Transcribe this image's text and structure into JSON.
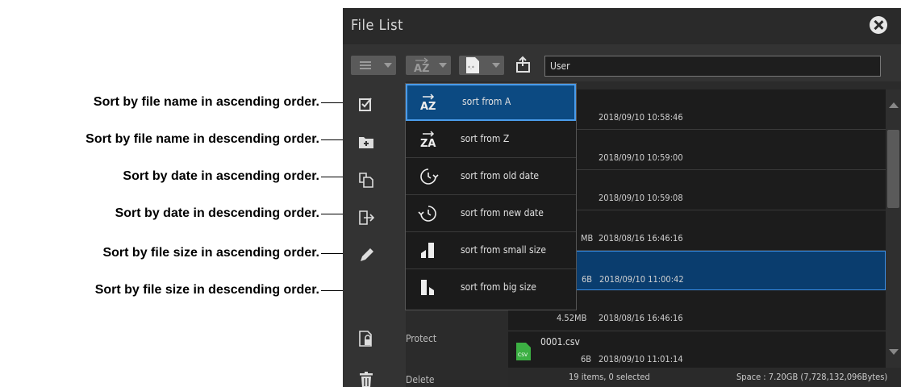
{
  "annotations": [
    "Sort by file name in ascending order.",
    "Sort by file name in descending order.",
    "Sort by date in ascending order.",
    "Sort by date in descending order.",
    "Sort by file size in ascending order.",
    "Sort by file size in descending order."
  ],
  "window": {
    "title": "File List",
    "close_icon": "close-circle-icon"
  },
  "toolbar": {
    "path_value": "User"
  },
  "sidebar": {
    "items": [
      {
        "icon": "select-check-icon",
        "label": ""
      },
      {
        "icon": "new-folder-icon",
        "label": ""
      },
      {
        "icon": "copy-icon",
        "label": ""
      },
      {
        "icon": "move-icon",
        "label": ""
      },
      {
        "icon": "rename-pencil-icon",
        "label": ""
      },
      {
        "icon": "protect-lock-icon",
        "label": "Protect"
      },
      {
        "icon": "trash-icon",
        "label": "Delete"
      }
    ]
  },
  "sort_menu": {
    "items": [
      {
        "label": "sort from A",
        "icon": "sort-az-icon"
      },
      {
        "label": "sort from Z",
        "icon": "sort-za-icon"
      },
      {
        "label": "sort from old date",
        "icon": "clock-forward-icon"
      },
      {
        "label": "sort from new date",
        "icon": "clock-backward-icon"
      },
      {
        "label": "sort from small size",
        "icon": "size-ascending-icon"
      },
      {
        "label": "sort from big size",
        "icon": "size-descending-icon"
      }
    ],
    "selected_index": 0
  },
  "files": [
    {
      "name": "",
      "size": "",
      "date": "2018/09/10 10:58:46",
      "icon": ""
    },
    {
      "name": "",
      "size": "",
      "date": "2018/09/10 10:59:00",
      "icon": ""
    },
    {
      "name": "",
      "size": "",
      "date": "2018/09/10 10:59:08",
      "icon": ""
    },
    {
      "name": "",
      "size": "MB",
      "date": "2018/08/16 16:46:16",
      "icon": ""
    },
    {
      "name": "",
      "size": "6B",
      "date": "2018/09/10 11:00:42",
      "icon": "",
      "selected": true
    },
    {
      "name": "",
      "size": "4.52MB",
      "date": "2018/08/16 16:46:16",
      "icon": "image-file-icon"
    },
    {
      "name": "0001.csv",
      "size": "6B",
      "date": "2018/09/10 11:01:14",
      "icon": "csv-file-icon"
    }
  ],
  "status": {
    "items": "19 items, 0 selected",
    "space": "Space : 7.20GB (7,728,132,096Bytes)"
  },
  "colors": {
    "selection": "#0c4a82",
    "selection_border": "#4a9bea",
    "panel": "#2b2b2b"
  }
}
